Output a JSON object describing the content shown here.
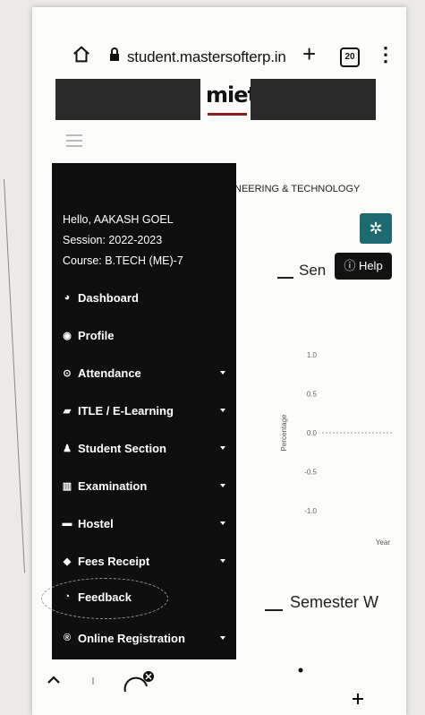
{
  "browser": {
    "url": "student.mastersofterp.in",
    "tab_count": "20"
  },
  "brand": {
    "logo_text": "miet"
  },
  "header": {
    "college_text": "NEERING & TECHNOLOGY"
  },
  "user": {
    "greeting": "Hello, AAKASH GOEL",
    "session": "Session: 2022-2023",
    "course": "Course: B.TECH (ME)-7"
  },
  "sidebar": {
    "items": [
      {
        "label": "Dashboard",
        "icon": "dashboard-icon"
      },
      {
        "label": "Profile",
        "icon": "profile-icon"
      },
      {
        "label": "Attendance",
        "icon": "clock-icon",
        "has_submenu": true
      },
      {
        "label": "ITLE / E-Learning",
        "icon": "graduation-cap-icon",
        "has_submenu": true
      },
      {
        "label": "Student Section",
        "icon": "user-icon",
        "has_submenu": true
      },
      {
        "label": "Examination",
        "icon": "institution-icon",
        "has_submenu": true
      },
      {
        "label": "Hostel",
        "icon": "bed-icon",
        "has_submenu": true
      },
      {
        "label": "Fees Receipt",
        "icon": "tag-icon",
        "has_submenu": true
      },
      {
        "label": "Feedback",
        "icon": "feedback-icon"
      },
      {
        "label": "Online Registration",
        "icon": "registered-icon",
        "has_submenu": true
      }
    ]
  },
  "main": {
    "help_label": "Help",
    "section1_title": "Sen",
    "section2_title": "Semester W"
  },
  "chart_data": {
    "type": "line",
    "ylabel": "Percentage",
    "xlabel": "Year",
    "y_ticks": [
      "1.0",
      "0.5",
      "0.0",
      "-0.5",
      "-1.0"
    ],
    "ylim": [
      -1.0,
      1.0
    ]
  }
}
